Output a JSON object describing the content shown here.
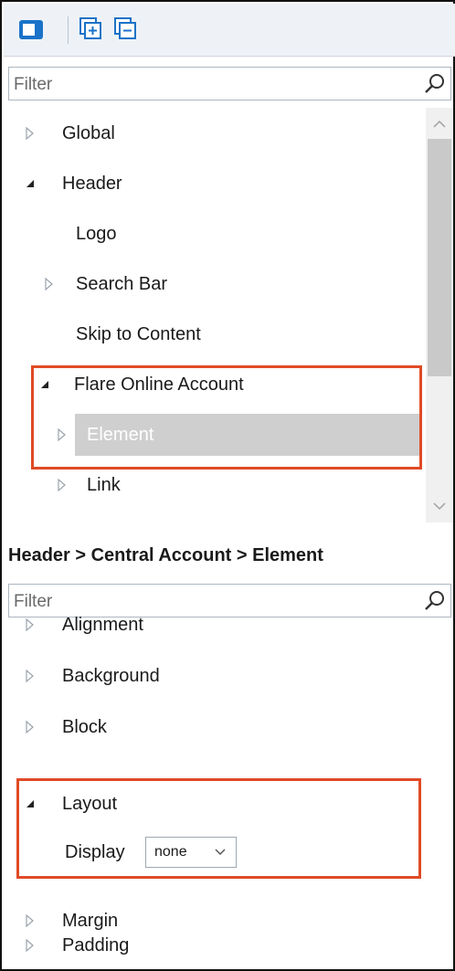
{
  "toolbar": {
    "buttons": [
      {
        "name": "toggle-pane-icon"
      },
      {
        "name": "expand-all-icon"
      },
      {
        "name": "collapse-all-icon"
      }
    ]
  },
  "top_filter": {
    "placeholder": "Filter"
  },
  "tree": {
    "items": [
      {
        "label": "Global",
        "state": "collapsed"
      },
      {
        "label": "Header",
        "state": "expanded"
      },
      {
        "label": "Logo",
        "state": "leaf"
      },
      {
        "label": "Search Bar",
        "state": "collapsed"
      },
      {
        "label": "Skip to Content",
        "state": "leaf"
      },
      {
        "label": "Flare Online Account",
        "state": "expanded"
      },
      {
        "label": "Element",
        "state": "collapsed",
        "selected": true
      },
      {
        "label": "Link",
        "state": "collapsed"
      }
    ]
  },
  "breadcrumb": {
    "text": "Header > Central Account > Element"
  },
  "bottom_filter": {
    "placeholder": "Filter"
  },
  "properties": {
    "groups": [
      {
        "label": "Alignment",
        "state": "collapsed"
      },
      {
        "label": "Background",
        "state": "collapsed"
      },
      {
        "label": "Block",
        "state": "collapsed"
      },
      {
        "label": "Layout",
        "state": "expanded"
      },
      {
        "label": "Margin",
        "state": "collapsed"
      },
      {
        "label": "Padding",
        "state": "collapsed"
      }
    ],
    "display": {
      "label": "Display",
      "value": "none"
    }
  },
  "colors": {
    "accent_blue": "#1a73c8",
    "highlight_border": "#e04a26",
    "selected_row": "#cfcfcf",
    "toolbar_bg": "#eef2f7"
  }
}
